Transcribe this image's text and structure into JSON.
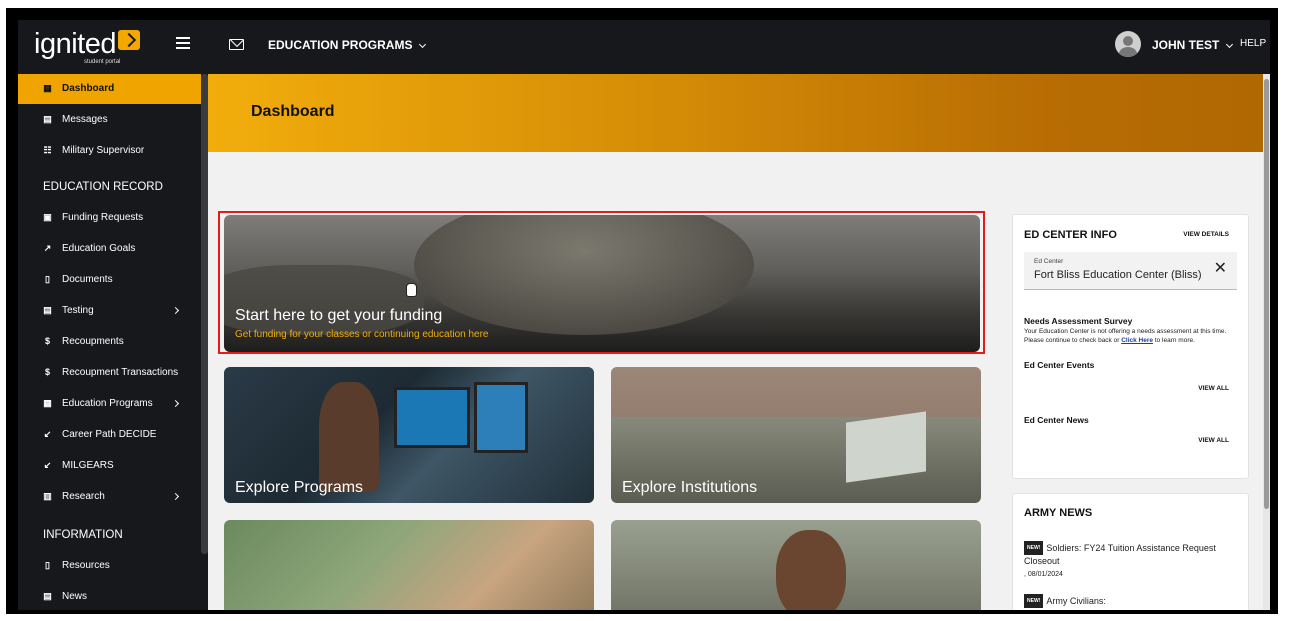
{
  "app": {
    "logo_text": "ignited",
    "logo_sub": "student portal"
  },
  "topbar": {
    "nav_label": "EDUCATION PROGRAMS",
    "user_name": "JOHN TEST",
    "help_label": "HELP"
  },
  "sidebar": {
    "top_items": [
      {
        "label": "Dashboard",
        "icon": "dashboard-icon",
        "active": true
      },
      {
        "label": "Messages",
        "icon": "messages-icon"
      },
      {
        "label": "Military Supervisor",
        "icon": "supervisor-icon"
      }
    ],
    "section_education": "EDUCATION RECORD",
    "education_items": [
      {
        "label": "Funding Requests",
        "icon": "funding-icon"
      },
      {
        "label": "Education Goals",
        "icon": "goals-icon"
      },
      {
        "label": "Documents",
        "icon": "document-icon"
      },
      {
        "label": "Testing",
        "icon": "testing-icon",
        "submenu": true
      },
      {
        "label": "Recoupments",
        "icon": "dollar-icon"
      },
      {
        "label": "Recoupment Transactions",
        "icon": "dollar-icon"
      },
      {
        "label": "Education Programs",
        "icon": "programs-icon",
        "submenu": true
      },
      {
        "label": "Career Path DECIDE",
        "icon": "external-link-icon"
      },
      {
        "label": "MILGEARS",
        "icon": "external-link-icon"
      },
      {
        "label": "Research",
        "icon": "research-icon",
        "submenu": true
      }
    ],
    "section_information": "INFORMATION",
    "information_items": [
      {
        "label": "Resources",
        "icon": "document-icon"
      },
      {
        "label": "News",
        "icon": "news-icon"
      }
    ]
  },
  "main": {
    "page_title": "Dashboard",
    "funding_card": {
      "title": "Start here to get your funding",
      "subtitle": "Get funding for your classes or continuing education here"
    },
    "tiles": {
      "programs": "Explore Programs",
      "institutions": "Explore Institutions"
    }
  },
  "ed_center": {
    "title": "ED CENTER INFO",
    "view_details": "VIEW DETAILS",
    "field_label": "Ed Center",
    "field_value": "Fort Bliss Education Center (Bliss)",
    "needs_title": "Needs Assessment Survey",
    "needs_text_1": "Your Education Center is not offering a needs assessment at this time. Please continue to check back or",
    "needs_link": "Click Here",
    "needs_text_2": "to learn more.",
    "events_title": "Ed Center Events",
    "events_view_all": "VIEW ALL",
    "news_title": "Ed Center News",
    "news_view_all": "VIEW ALL"
  },
  "army_news": {
    "title": "ARMY NEWS",
    "badge": "NEW!",
    "items": [
      {
        "headline": "Soldiers: FY24 Tuition Assistance Request Closeout",
        "date": ", 08/01/2024"
      },
      {
        "headline": "Army Civilians:",
        "date": ""
      }
    ]
  }
}
